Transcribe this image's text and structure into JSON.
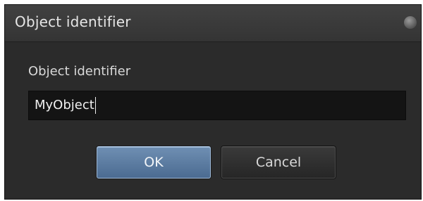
{
  "dialog": {
    "title": "Object identifier"
  },
  "form": {
    "label": "Object identifier",
    "value": "MyObject"
  },
  "buttons": {
    "ok_label": "OK",
    "cancel_label": "Cancel"
  },
  "icons": {
    "title_bar_corner": "close-dot-icon"
  },
  "colors": {
    "dialog_bg": "#2b2b2b",
    "titlebar_bg": "#3a3a3a",
    "field_bg": "#141414",
    "ok_button": "#5a7aa0",
    "cancel_button": "#303030"
  }
}
